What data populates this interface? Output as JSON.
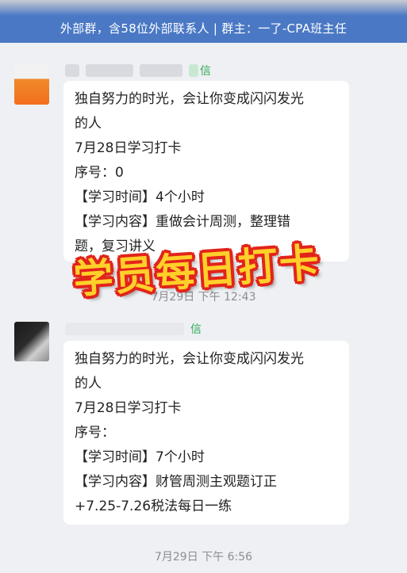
{
  "group_banner": {
    "text": "外部群，含58位外部联系人 | 群主：一了-CPA班主任"
  },
  "messages": [
    {
      "sender_suffix": "信",
      "lines": [
        "独自努力的时光，会让你变成闪闪发光",
        "的人",
        "7月28日学习打卡",
        "序号：0",
        "【学习时间】4个小时",
        "【学习内容】重做会计周测，整理错",
        "题，复习讲义"
      ],
      "timestamp": "7月29日 下午 12:43"
    },
    {
      "sender_suffix": "信",
      "lines": [
        "独自努力的时光，会让你变成闪闪发光",
        "的人",
        "7月28日学习打卡",
        "序号：",
        "【学习时间】7个小时",
        "【学习内容】财管周测主观题订正",
        "+7.25-7.26税法每日一练"
      ],
      "timestamp": "7月29日 下午 6:56"
    }
  ],
  "overlay": {
    "stamp_text": "学员每日打卡",
    "stamp_color": "#ffd02a",
    "stamp_outline": "#e2241b"
  },
  "colors": {
    "banner": "#4a78c4",
    "chat_background": "#eef0f3",
    "bubble": "#ffffff",
    "sender_suffix": "#2eaa57"
  }
}
